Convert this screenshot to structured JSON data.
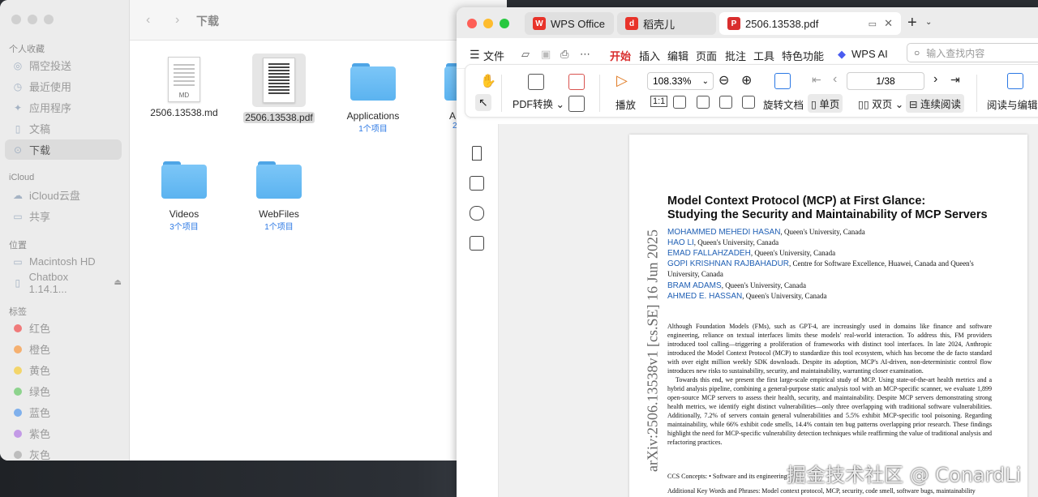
{
  "finder": {
    "title": "下载",
    "sections": {
      "favorites": "个人收藏",
      "icloud": "iCloud",
      "locations": "位置",
      "tags": "标签"
    },
    "favorites": [
      "隔空投送",
      "最近使用",
      "应用程序",
      "文稿",
      "下载"
    ],
    "icloud_items": [
      "iCloud云盘",
      "共享"
    ],
    "locations": [
      "Macintosh HD",
      "Chatbox 1.14.1..."
    ],
    "tags": [
      {
        "label": "红色",
        "color": "#f07a7a"
      },
      {
        "label": "橙色",
        "color": "#f5b070"
      },
      {
        "label": "黄色",
        "color": "#f3d56a"
      },
      {
        "label": "绿色",
        "color": "#8dd38d"
      },
      {
        "label": "蓝色",
        "color": "#7fb0ec"
      },
      {
        "label": "紫色",
        "color": "#c39ae6"
      },
      {
        "label": "灰色",
        "color": "#bdbdbd"
      }
    ],
    "files": [
      {
        "name": "2506.13538.md",
        "tag": "MD"
      },
      {
        "name": "2506.13538.pdf"
      },
      {
        "name": "Applications",
        "sub": "1个项目"
      },
      {
        "name": "A",
        "sub": "2"
      },
      {
        "name": "Videos",
        "sub": "3个项目"
      },
      {
        "name": "WebFiles",
        "sub": "1个项目"
      }
    ]
  },
  "wps": {
    "tabs": [
      "WPS Office",
      "稻壳儿",
      "2506.13538.pdf"
    ],
    "menu": [
      "文件",
      "开始",
      "插入",
      "编辑",
      "页面",
      "批注",
      "工具",
      "特色功能",
      "WPS AI"
    ],
    "search_placeholder": "输入查找内容",
    "ribbon": {
      "pdf_convert": "PDF转换",
      "play": "播放",
      "zoom": "108.33%",
      "rotate": "旋转文档",
      "page": "1/38",
      "single": "单页",
      "double": "双页",
      "continuous": "连续阅读",
      "read_edit": "阅读与编辑"
    }
  },
  "paper": {
    "title1": "Model Context Protocol (MCP) at First Glance:",
    "title2": "Studying the Security and Maintainability of MCP Servers",
    "arxiv": "arXiv:2506.13538v1  [cs.SE]  16 Jun 2025",
    "authors": [
      {
        "name": "MOHAMMED MEHEDI HASAN",
        "aff": ", Queen's University, Canada"
      },
      {
        "name": "HAO LI",
        "aff": ", Queen's University, Canada"
      },
      {
        "name": "EMAD FALLAHZADEH",
        "aff": ", Queen's University, Canada"
      },
      {
        "name": "GOPI KRISHNAN RAJBAHADUR",
        "aff": ", Centre for Software Excellence, Huawei, Canada and Queen's University, Canada"
      },
      {
        "name": "BRAM ADAMS",
        "aff": ", Queen's University, Canada"
      },
      {
        "name": "AHMED E. HASSAN",
        "aff": ", Queen's University, Canada"
      }
    ],
    "abstract1": "Although Foundation Models (FMs), such as GPT-4, are increasingly used in domains like finance and software engineering, reliance on textual interfaces limits these models' real-world interaction. To address this, FM providers introduced tool calling—triggering a proliferation of frameworks with distinct tool interfaces. In late 2024, Anthropic introduced the Model Context Protocol (MCP) to standardize this tool ecosystem, which has become the de facto standard with over eight million weekly SDK downloads. Despite its adoption, MCP's AI-driven, non-deterministic control flow introduces new risks to sustainability, security, and maintainability, warranting closer examination.",
    "abstract2": "Towards this end, we present the first large-scale empirical study of MCP. Using state-of-the-art health metrics and a hybrid analysis pipeline, combining a general-purpose static analysis tool with an MCP-specific scanner, we evaluate 1,899 open-source MCP servers to assess their health, security, and maintainability. Despite MCP servers demonstrating strong health metrics, we identify eight distinct vulnerabilities—only three overlapping with traditional software vulnerabilities. Additionally, 7.2% of servers contain general vulnerabilities and 5.5% exhibit MCP-specific tool poisoning. Regarding maintainability, while 66% exhibit code smells, 14.4% contain ten bug patterns overlapping prior research. These findings highlight the need for MCP-specific vulnerability detection techniques while reaffirming the value of traditional analysis and refactoring practices.",
    "ccs": "CCS Concepts: • Software and its engineering",
    "keywords": "Additional Key Words and Phrases: Model context protocol, MCP, security, code smell, software bugs, maintainability"
  },
  "watermark": "掘金技术社区 @ ConardLi"
}
